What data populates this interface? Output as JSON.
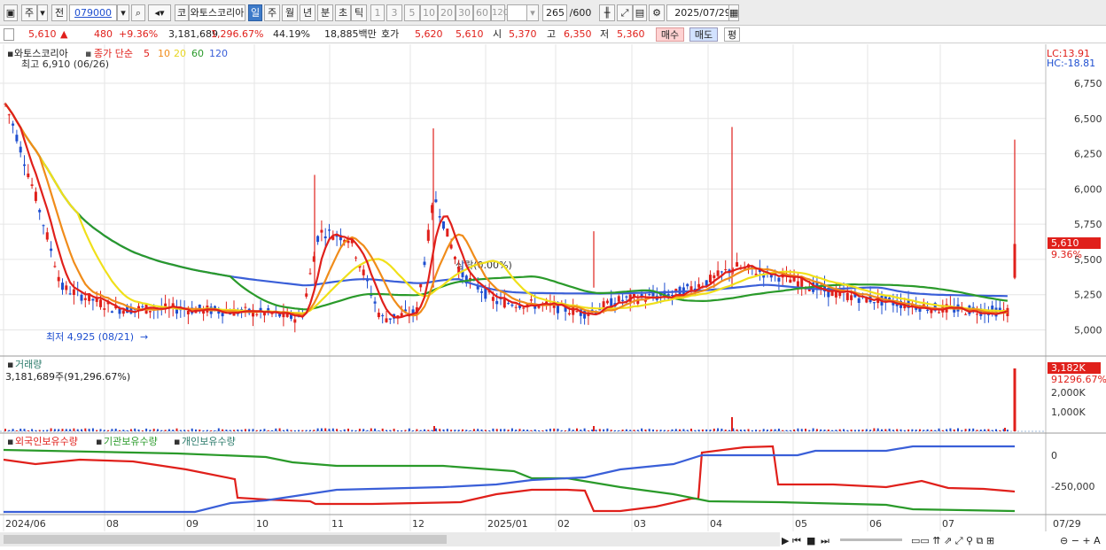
{
  "toolbar": {
    "period_day": "주",
    "prev": "전",
    "code": "079000",
    "market": "코",
    "name": "와토스코리아",
    "tabs": [
      "일",
      "주",
      "월",
      "년",
      "분",
      "초",
      "틱"
    ],
    "intervals": [
      "1",
      "3",
      "5",
      "10",
      "20",
      "30",
      "60",
      "120"
    ],
    "count": "265",
    "count_max": "/600",
    "date": "2025/07/29"
  },
  "info": {
    "price": "5,610",
    "change": "480",
    "rate": "+9.36%",
    "volume": "3,181,689",
    "vol_rate": "1,296.67%",
    "turnover": "44.19%",
    "amount": "18,885백만",
    "ask_label": "호가",
    "ask": "5,620",
    "bid": "5,610",
    "open_label": "시",
    "open": "5,370",
    "high_label": "고",
    "high": "6,350",
    "low_label": "저",
    "low": "5,360",
    "buy": "매수",
    "sell": "매도",
    "avg": "평"
  },
  "price_panel": {
    "title": "와토스코리아",
    "ma_label": "종가 단순",
    "ma": [
      "5",
      "10",
      "20",
      "60",
      "120"
    ],
    "high_note": "최고 6,910 (06/26)",
    "low_note": "최저 4,925 (08/21)",
    "mid_note": "상락(0.00%)",
    "lc": "LC:13.91",
    "hc": "HC:-18.81",
    "yticks": [
      "6,750",
      "6,500",
      "6,250",
      "6,000",
      "5,750",
      "5,500",
      "5,250",
      "5,000"
    ],
    "price_tag": "5,610",
    "pct_tag": "9.36%"
  },
  "volume_panel": {
    "title": "거래량",
    "value": "3,181,689주(91,296.67%)",
    "yticks": [
      "2,000K",
      "1,000K"
    ],
    "tag": "3,182K",
    "tag2": "91296.67%"
  },
  "holding_panel": {
    "labels": [
      "외국인보유수량",
      "기관보유수량",
      "개인보유수량"
    ],
    "yticks": [
      "0",
      "-250,000"
    ]
  },
  "xaxis": [
    "2024/06",
    "08",
    "09",
    "10",
    "11",
    "12",
    "2025/01",
    "02",
    "03",
    "04",
    "05",
    "06",
    "07"
  ],
  "xaxis_right": "07/29",
  "colors": {
    "up": "#e0201b",
    "down": "#1f4fd0",
    "ma5": "#e0201b",
    "ma10": "#f08c1a",
    "ma20": "#f0e01a",
    "ma60": "#2a9a2a",
    "ma120": "#3a5fd8"
  }
}
